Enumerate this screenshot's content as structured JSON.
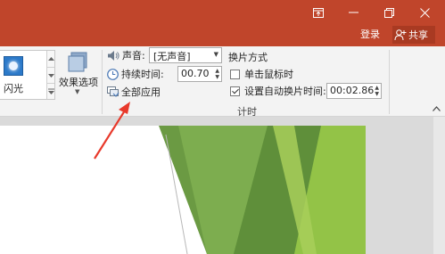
{
  "window": {
    "login_label": "登录",
    "share_label": "共享",
    "accent_color": "#c0452b"
  },
  "ribbon": {
    "transition_gallery": {
      "items": [
        {
          "label": "闪光",
          "icon": "flash-transition-icon"
        }
      ]
    },
    "effect_options": {
      "label": "效果选项",
      "icon": "effect-options-icon"
    },
    "timing": {
      "group_label": "计时",
      "sound": {
        "label": "声音:",
        "value": "[无声音]",
        "icon": "speaker-icon"
      },
      "duration": {
        "label": "持续时间:",
        "value": "00.70",
        "icon": "clock-icon"
      },
      "apply_all": {
        "label": "全部应用",
        "icon": "apply-all-icon"
      },
      "advance_slide": {
        "heading": "换片方式",
        "on_click": {
          "label": "单击鼠标时",
          "checked": false
        },
        "after_time": {
          "label": "设置自动换片时间:",
          "checked": true,
          "value": "00:02.86"
        }
      }
    }
  },
  "annotation": {
    "color": "#e8392b"
  }
}
